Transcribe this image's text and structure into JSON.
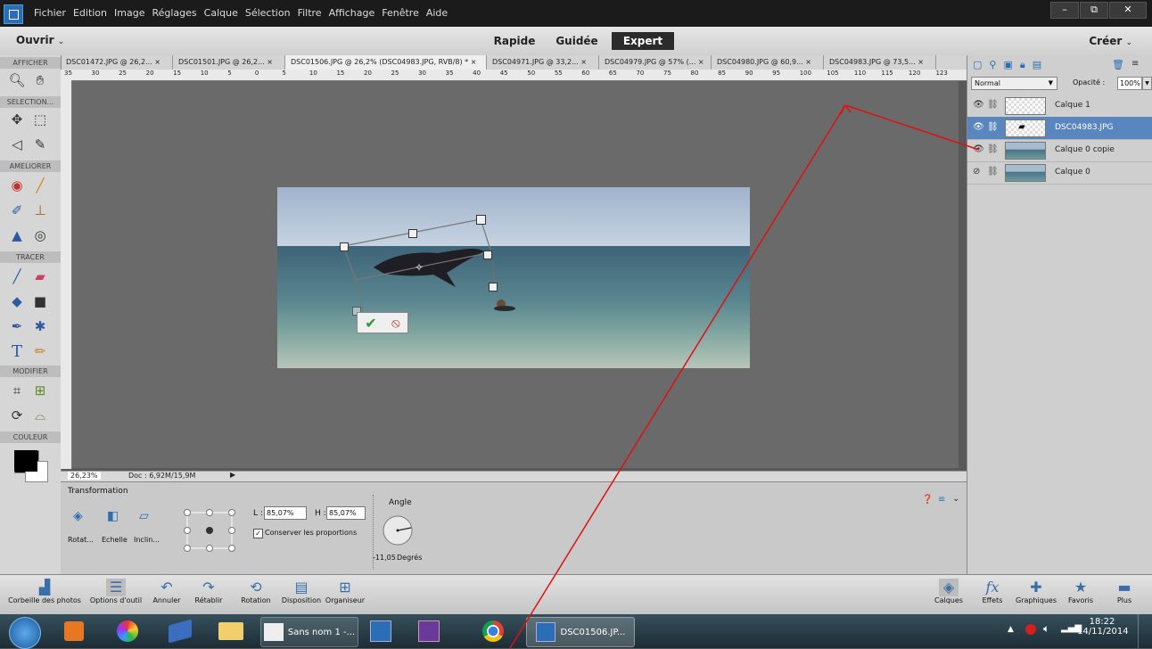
{
  "menu": {
    "items": [
      "Fichier",
      "Edition",
      "Image",
      "Réglages",
      "Calque",
      "Sélection",
      "Filtre",
      "Affichage",
      "Fenêtre",
      "Aide"
    ],
    "window_buttons": [
      "–",
      "⧉",
      "✕"
    ]
  },
  "modebar": {
    "open_label": "Ouvrir",
    "create_label": "Créer",
    "modes": [
      "Rapide",
      "Guidée",
      "Expert"
    ],
    "active_mode": "Expert"
  },
  "tabs": [
    "DSC01472.JPG @ 26,2...",
    "DSC01501.JPG @ 26,2...",
    "DSC01506.JPG @ 26,2% (DSC04983.JPG, RVB/8) *",
    "DSC04971.JPG @ 33,2...",
    "DSC04979.JPG @ 57% (...",
    "DSC04980.JPG @ 60,9...",
    "DSC04983.JPG @ 73,5..."
  ],
  "leftbar": {
    "sections": [
      "AFFICHER",
      "SELECTION...",
      "AMELIORER",
      "TRACER",
      "MODIFIER",
      "COULEUR"
    ]
  },
  "ruler_labels": [
    "35",
    "30",
    "25",
    "20",
    "15",
    "10",
    "5",
    "0",
    "5",
    "10",
    "15",
    "20",
    "25",
    "30",
    "35",
    "40",
    "45",
    "50",
    "55",
    "60",
    "65",
    "70",
    "75",
    "80",
    "85",
    "90",
    "95",
    "100",
    "105",
    "110",
    "115",
    "120",
    "123"
  ],
  "status": {
    "zoom": "26,23%",
    "doc": "Doc : 6,92M/15,9M"
  },
  "options": {
    "title": "Transformation",
    "tool_labels": [
      "Rotat...",
      "Echelle",
      "Inclin..."
    ],
    "width_label": "L :",
    "width_value": "85,07%",
    "height_label": "H :",
    "height_value": "85,07%",
    "proportions_label": "Conserver les proportions",
    "angle_label": "Angle",
    "angle_value": "-11,05",
    "degrees_label": "Degrés"
  },
  "layers_panel": {
    "blend_mode": "Normal",
    "opacity_label": "Opacité :",
    "opacity_value": "100%",
    "layers": [
      {
        "name": "Calque 1",
        "selected": false
      },
      {
        "name": "DSC04983.JPG",
        "selected": true
      },
      {
        "name": "Calque 0 copie",
        "selected": false
      },
      {
        "name": "Calque 0",
        "selected": false
      }
    ]
  },
  "dock": {
    "left_items": [
      "Corbeille des photos",
      "Options d'outil",
      "Annuler",
      "Rétablir",
      "Rotation",
      "Disposition",
      "Organiseur"
    ],
    "right_items": [
      "Calques",
      "Effets",
      "Graphiques",
      "Favoris",
      "Plus"
    ]
  },
  "taskbar": {
    "items": [
      "Sans nom 1 -...",
      "DSC01506.JP..."
    ],
    "time": "18:22",
    "date": "14/11/2014"
  }
}
